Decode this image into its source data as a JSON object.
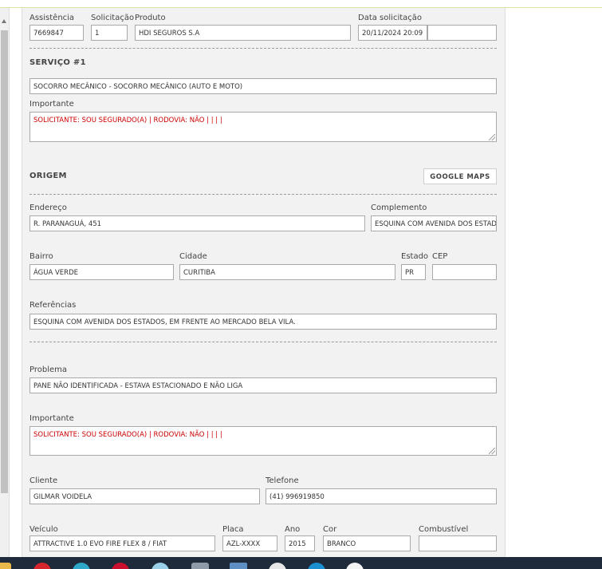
{
  "header": {
    "assistencia_label": "Assistência",
    "assistencia_value": "7669847",
    "solicitacao_label": "Solicitação",
    "solicitacao_value": "1",
    "produto_label": "Produto",
    "produto_value": "HDI SEGUROS S.A",
    "data_label": "Data solicitação",
    "data_value": "20/11/2024 20:09",
    "data_extra_value": ""
  },
  "servico": {
    "title": "SERVIÇO #1",
    "service_value": "SOCORRO MECÂNICO - SOCORRO MECÂNICO (AUTO E MOTO)",
    "importante_label": "Importante",
    "importante_value": "SOLICITANTE: SOU SEGURADO(A) | RODOVIA: NÃO |  |  |  |"
  },
  "origem": {
    "title": "ORIGEM",
    "maps_button": "GOOGLE MAPS",
    "endereco_label": "Endereço",
    "endereco_value": "R. PARANAGUÁ, 451",
    "complemento_label": "Complemento",
    "complemento_value": "ESQUINA COM AVENIDA DOS ESTADOS",
    "bairro_label": "Bairro",
    "bairro_value": "ÁGUA VERDE",
    "cidade_label": "Cidade",
    "cidade_value": "CURITIBA",
    "estado_label": "Estado",
    "estado_value": "PR",
    "cep_label": "CEP",
    "cep_value": "",
    "referencias_label": "Referências",
    "referencias_value": "ESQUINA COM AVENIDA DOS ESTADOS, EM FRENTE AO MERCADO BELA VILA."
  },
  "problema": {
    "problema_label": "Problema",
    "problema_value": "PANE NÃO IDENTIFICADA - ESTAVA ESTACIONADO E NÃO LIGA",
    "importante_label": "Importante",
    "importante_value": "SOLICITANTE: SOU SEGURADO(A) | RODOVIA: NÃO |  |  |  |"
  },
  "cliente": {
    "cliente_label": "Cliente",
    "cliente_value": "GILMAR VOIDELA",
    "telefone_label": "Telefone",
    "telefone_value": "(41) 996919850"
  },
  "veiculo": {
    "veiculo_label": "Veículo",
    "veiculo_value": "ATTRACTIVE 1.0 EVO FIRE FLEX 8 / FIAT",
    "placa_label": "Placa",
    "placa_value": "AZL-XXXX",
    "ano_label": "Ano",
    "ano_value": "2015",
    "cor_label": "Cor",
    "cor_value": "BRANCO",
    "combustivel_label": "Combustível",
    "combustivel_value": ""
  },
  "colors": {
    "important_text": "#cc0000",
    "panel_bg": "#f2f2f2",
    "taskbar_bg": "#1f2b3a"
  },
  "taskbar": {
    "icons": [
      "folder-icon",
      "opera-icon",
      "edge-icon",
      "opera-gx-icon",
      "chrome-canary-icon",
      "file-explorer-icon",
      "store-icon",
      "chrome-icon",
      "edge-dev-icon",
      "chrome-alt-icon"
    ]
  }
}
